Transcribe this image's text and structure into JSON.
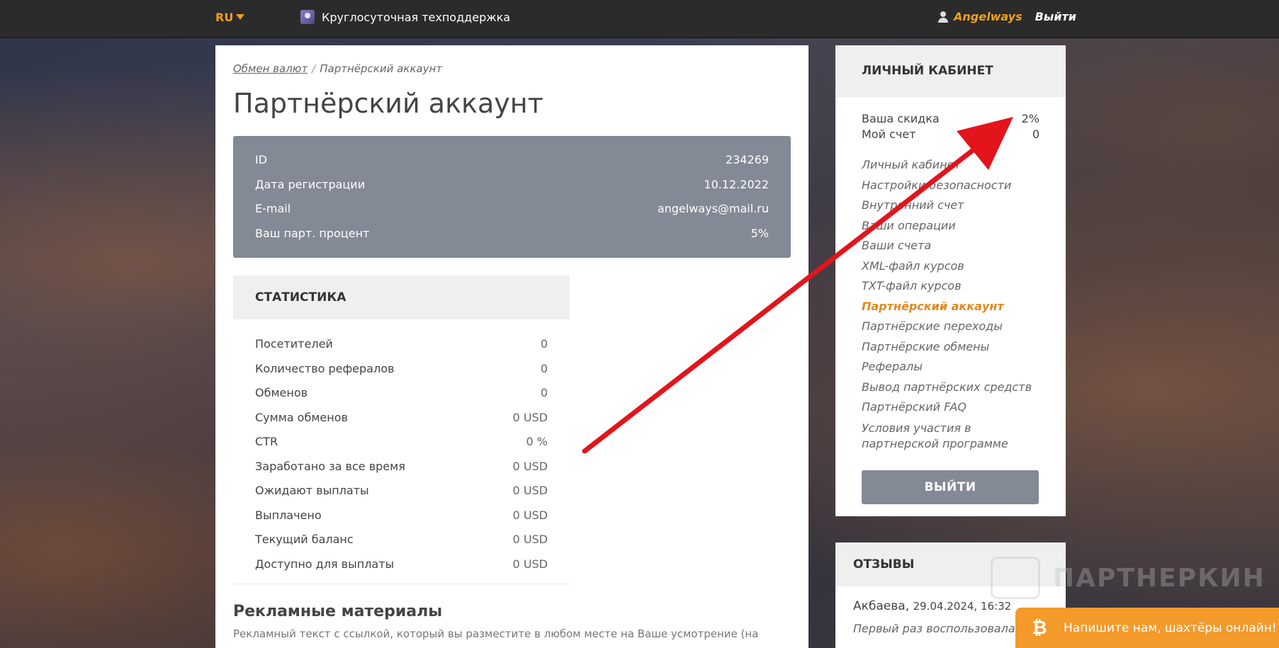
{
  "topbar": {
    "lang": "RU",
    "support": "Круглосуточная техподдержка",
    "username": "Angelways",
    "logout": "Выйти"
  },
  "main": {
    "breadcrumb": {
      "home": "Обмен валют",
      "separator": "/",
      "current": "Партнёрский аккаунт"
    },
    "title": "Партнёрский аккаунт",
    "info": [
      {
        "label": "ID",
        "value": "234269"
      },
      {
        "label": "Дата регистрации",
        "value": "10.12.2022"
      },
      {
        "label": "E-mail",
        "value": "angelways@mail.ru"
      },
      {
        "label": "Ваш парт. процент",
        "value": "5%"
      }
    ],
    "stats_title": "СТАТИСТИКА",
    "stats": [
      {
        "label": "Посетителей",
        "value": "0"
      },
      {
        "label": "Количество рефералов",
        "value": "0"
      },
      {
        "label": "Обменов",
        "value": "0"
      },
      {
        "label": "Сумма обменов",
        "value": "0 USD"
      },
      {
        "label": "CTR",
        "value": "0 %"
      },
      {
        "label": "Заработано за все время",
        "value": "0 USD"
      },
      {
        "label": "Ожидают выплаты",
        "value": "0 USD"
      },
      {
        "label": "Выплачено",
        "value": "0 USD"
      },
      {
        "label": "Текущий баланс",
        "value": "0 USD"
      },
      {
        "label": "Доступно для выплаты",
        "value": "0 USD"
      }
    ],
    "ads_title": "Рекламные материалы",
    "ads_text": "Рекламный текст с ссылкой, который вы разместите в любом месте на Ваше усмотрение (на"
  },
  "sidebar": {
    "title": "ЛИЧНЫЙ КАБИНЕТ",
    "discount_label": "Ваша скидка",
    "discount_value": "2%",
    "account_label": "Мой счет",
    "account_value": "0",
    "menu": [
      "Личный кабинет",
      "Настройки безопасности",
      "Внутренний счет",
      "Ваши операции",
      "Ваши счета",
      "XML-файл курсов",
      "TXT-файл курсов",
      "Партнёрский аккаунт",
      "Партнёрские переходы",
      "Партнёрские обмены",
      "Рефералы",
      "Вывод партнёрских средств",
      "Партнёрский FAQ",
      "Условия участия в партнерской программе"
    ],
    "active_index": 7,
    "logout_button": "ВЫЙТИ"
  },
  "reviews": {
    "title": "ОТЗЫВЫ",
    "author": "Акбаева,",
    "date": "29.04.2024, 16:32",
    "text": "Первый раз воспользовалась"
  },
  "watermark": "ПАРТНЕРКИН",
  "chat": {
    "label": "Напишите нам, шахтёры онлайн!",
    "icon": "bitcoin-icon"
  },
  "colors": {
    "accent": "#f0a020",
    "active_menu": "#e08a1e",
    "info_box": "#848996",
    "chat": "#f39a2b",
    "arrow": "#e3141b"
  }
}
